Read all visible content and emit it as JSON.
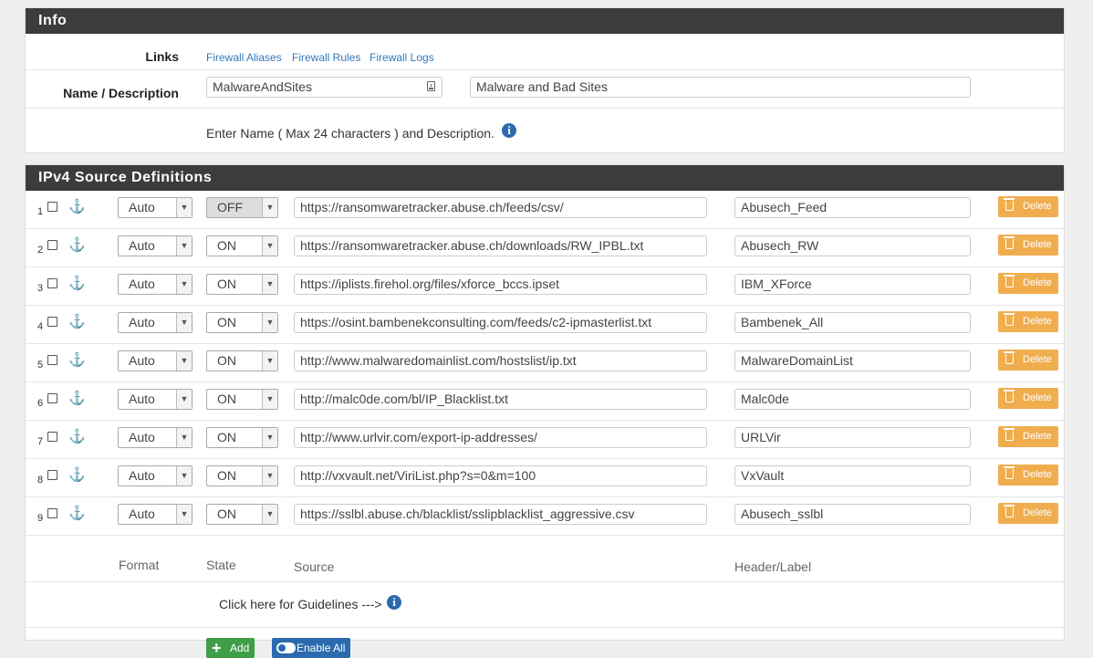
{
  "info": {
    "heading": "Info",
    "links_label": "Links",
    "links": [
      "Firewall Aliases",
      "Firewall Rules",
      "Firewall Logs"
    ],
    "name_label": "Name / Description",
    "name_value": "MalwareAndSites",
    "description_value": "Malware and Bad Sites",
    "help_text": "Enter Name ( Max 24 characters ) and Description."
  },
  "sources": {
    "heading": "IPv4 Source Definitions",
    "delete_label": "Delete",
    "rows": [
      {
        "num": "1",
        "format": "Auto",
        "state": "OFF",
        "url": "https://ransomwaretracker.abuse.ch/feeds/csv/",
        "label": "Abusech_Feed"
      },
      {
        "num": "2",
        "format": "Auto",
        "state": "ON",
        "url": "https://ransomwaretracker.abuse.ch/downloads/RW_IPBL.txt",
        "label": "Abusech_RW"
      },
      {
        "num": "3",
        "format": "Auto",
        "state": "ON",
        "url": "https://iplists.firehol.org/files/xforce_bccs.ipset",
        "label": "IBM_XForce"
      },
      {
        "num": "4",
        "format": "Auto",
        "state": "ON",
        "url": "https://osint.bambenekconsulting.com/feeds/c2-ipmasterlist.txt",
        "label": "Bambenek_All"
      },
      {
        "num": "5",
        "format": "Auto",
        "state": "ON",
        "url": "http://www.malwaredomainlist.com/hostslist/ip.txt",
        "label": "MalwareDomainList"
      },
      {
        "num": "6",
        "format": "Auto",
        "state": "ON",
        "url": "http://malc0de.com/bl/IP_Blacklist.txt",
        "label": "Malc0de"
      },
      {
        "num": "7",
        "format": "Auto",
        "state": "ON",
        "url": "http://www.urlvir.com/export-ip-addresses/",
        "label": "URLVir"
      },
      {
        "num": "8",
        "format": "Auto",
        "state": "ON",
        "url": "http://vxvault.net/ViriList.php?s=0&m=100",
        "label": "VxVault"
      },
      {
        "num": "9",
        "format": "Auto",
        "state": "ON",
        "url": "https://sslbl.abuse.ch/blacklist/sslipblacklist_aggressive.csv",
        "label": "Abusech_sslbl"
      }
    ],
    "columns": {
      "format": "Format",
      "state": "State",
      "source": "Source",
      "label": "Header/Label"
    },
    "guidelines_text": "Click here for Guidelines --->",
    "add_label": "Add",
    "enable_all_label": "Enable All"
  }
}
